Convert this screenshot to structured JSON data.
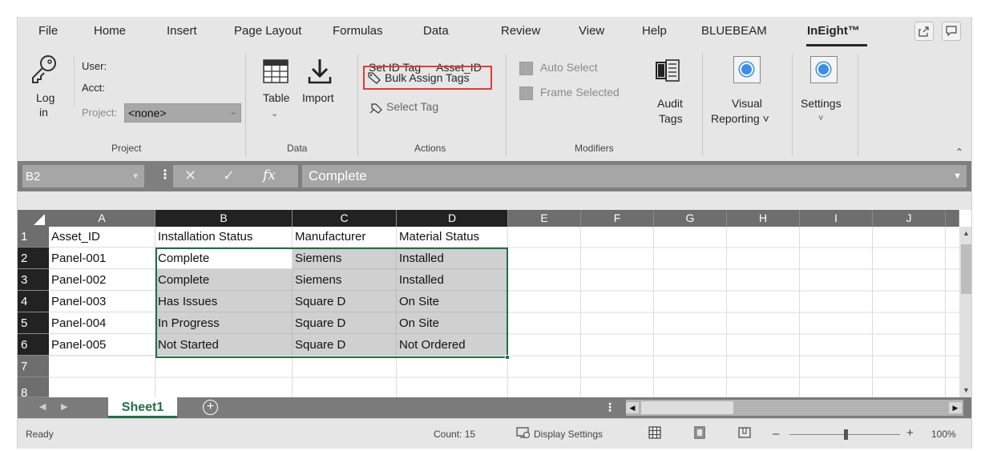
{
  "menu": {
    "tabs": [
      "File",
      "Home",
      "Insert",
      "Page Layout",
      "Formulas",
      "Data",
      "Review",
      "View",
      "Help",
      "BLUEBEAM",
      "InEight™"
    ],
    "active_tab": "InEight™"
  },
  "ribbon": {
    "project": {
      "login_label_1": "Log",
      "login_label_2": "in",
      "user_label": "User:",
      "acct_label": "Acct:",
      "project_label": "Project:",
      "project_value": "<none>",
      "group_label": "Project"
    },
    "data": {
      "table_label": "Table",
      "import_label": "Import",
      "group_label": "Data"
    },
    "actions": {
      "set_id_tag_label": "Set ID Tag",
      "set_id_tag_value": "Asset_ID",
      "bulk_assign_label": "Bulk Assign Tags",
      "select_tag_label": "Select Tag",
      "group_label": "Actions"
    },
    "modifiers": {
      "auto_select_label": "Auto Select",
      "frame_selected_label": "Frame Selected",
      "group_label": "Modifiers"
    },
    "audit_tags_label_1": "Audit",
    "audit_tags_label_2": "Tags",
    "visual_reporting_label_1": "Visual",
    "visual_reporting_label_2": "Reporting ˅",
    "settings_label": "Settings",
    "settings_chevron": "˅"
  },
  "formula_bar": {
    "name_box": "B2",
    "formula_value": "Complete"
  },
  "grid": {
    "columns": [
      "A",
      "B",
      "C",
      "D",
      "E",
      "F",
      "G",
      "H",
      "I",
      "J"
    ],
    "row_numbers": [
      "1",
      "2",
      "3",
      "4",
      "5",
      "6",
      "7",
      "8"
    ],
    "rows": [
      [
        "Asset_ID",
        "Installation Status",
        "Manufacturer",
        "Material Status"
      ],
      [
        "Panel-001",
        "Complete",
        "Siemens",
        "Installed"
      ],
      [
        "Panel-002",
        "Complete",
        "Siemens",
        "Installed"
      ],
      [
        "Panel-003",
        "Has Issues",
        "Square D",
        "On Site"
      ],
      [
        "Panel-004",
        "In Progress",
        "Square D",
        "On Site"
      ],
      [
        "Panel-005",
        "Not Started",
        "Square D",
        "Not Ordered"
      ]
    ]
  },
  "sheet_tabs": {
    "active_sheet": "Sheet1"
  },
  "status_bar": {
    "ready": "Ready",
    "count": "Count: 15",
    "display_settings": "Display Settings",
    "zoom_minus": "–",
    "zoom_plus": "+",
    "zoom_level": "100%"
  },
  "colors": {
    "accent_green": "#1e7145",
    "highlight_red": "#e53935"
  }
}
